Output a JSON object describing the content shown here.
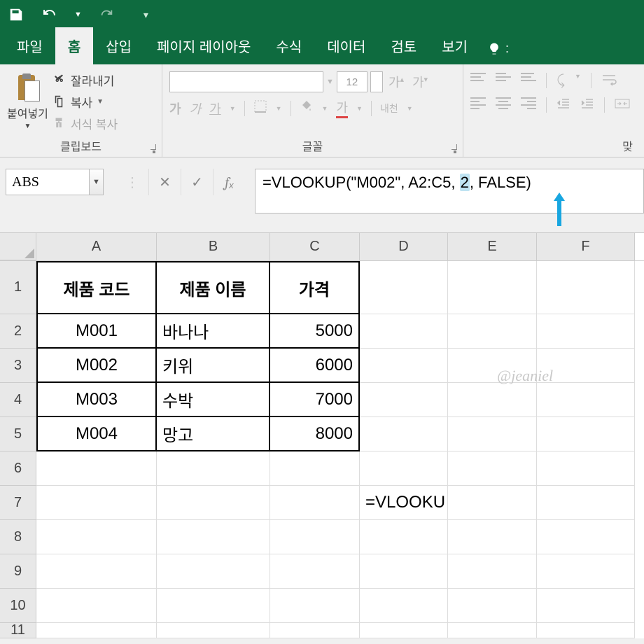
{
  "qat": {
    "save": "save-icon",
    "undo": "undo-icon",
    "redo": "redo-icon"
  },
  "tabs": {
    "file": "파일",
    "home": "홈",
    "insert": "삽입",
    "layout": "페이지 레이아웃",
    "formulas": "수식",
    "data": "데이터",
    "review": "검토",
    "view": "보기"
  },
  "clipboard": {
    "paste": "붙여넣기",
    "cut": "잘라내기",
    "copy": "복사",
    "fmt": "서식 복사",
    "group": "클립보드"
  },
  "font": {
    "size": "12",
    "group": "글꼴",
    "bold": "가",
    "italic": "가",
    "underline": "가",
    "grow": "가",
    "shrink": "가",
    "fontcolor": "가",
    "wrap": "내천"
  },
  "align": {
    "group": "맞"
  },
  "namebox": "ABS",
  "formula_parts": {
    "p1": "=VLOOKUP(\"M002\", A2:C5, ",
    "hl": "2",
    "p2": ", FALSE)"
  },
  "columns": [
    "A",
    "B",
    "C",
    "D",
    "E",
    "F"
  ],
  "table": {
    "headers": {
      "a": "제품 코드",
      "b": "제품 이름",
      "c": "가격"
    },
    "rows": [
      {
        "a": "M001",
        "b": "바나나",
        "c": "5000"
      },
      {
        "a": "M002",
        "b": "키위",
        "c": "6000"
      },
      {
        "a": "M003",
        "b": "수박",
        "c": "7000"
      },
      {
        "a": "M004",
        "b": "망고",
        "c": "8000"
      }
    ]
  },
  "d7": "=VLOOKU",
  "row_labels": [
    "1",
    "2",
    "3",
    "4",
    "5",
    "6",
    "7",
    "8",
    "9",
    "10",
    "11"
  ],
  "watermark": "@jeaniel"
}
